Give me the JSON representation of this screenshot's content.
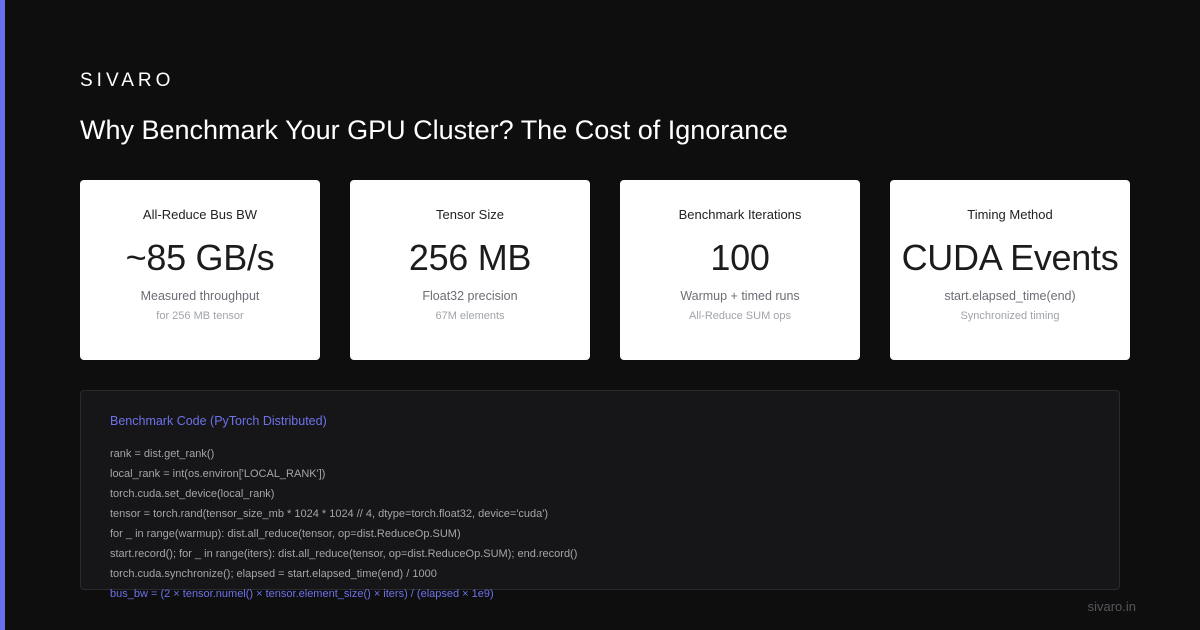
{
  "brand": "SIVARO",
  "title": "Why Benchmark Your GPU Cluster? The Cost of Ignorance",
  "colors": {
    "accent": "#6a6ff0",
    "background": "#0e0e0f",
    "card": "#ffffff",
    "code_panel": "#161619"
  },
  "cards": [
    {
      "label": "All-Reduce Bus BW",
      "value": "~85 GB/s",
      "sub": "Measured throughput",
      "note": "for 256 MB tensor"
    },
    {
      "label": "Tensor Size",
      "value": "256 MB",
      "sub": "Float32 precision",
      "note": "67M elements"
    },
    {
      "label": "Benchmark Iterations",
      "value": "100",
      "sub": "Warmup + timed runs",
      "note": "All-Reduce SUM ops"
    },
    {
      "label": "Timing Method",
      "value": "CUDA Events",
      "sub": "start.elapsed_time(end)",
      "note": "Synchronized timing"
    }
  ],
  "code": {
    "title": "Benchmark Code (PyTorch Distributed)",
    "lines": [
      "rank = dist.get_rank()",
      "local_rank = int(os.environ['LOCAL_RANK'])",
      "torch.cuda.set_device(local_rank)",
      "tensor = torch.rand(tensor_size_mb * 1024 * 1024 // 4, dtype=torch.float32, device='cuda')",
      "for _ in range(warmup): dist.all_reduce(tensor, op=dist.ReduceOp.SUM)",
      "start.record(); for _ in range(iters): dist.all_reduce(tensor, op=dist.ReduceOp.SUM); end.record()",
      "torch.cuda.synchronize(); elapsed = start.elapsed_time(end) / 1000",
      "bus_bw = (2 × tensor.numel() × tensor.element_size() × iters) / (elapsed × 1e9)"
    ]
  },
  "footer": "sivaro.in"
}
